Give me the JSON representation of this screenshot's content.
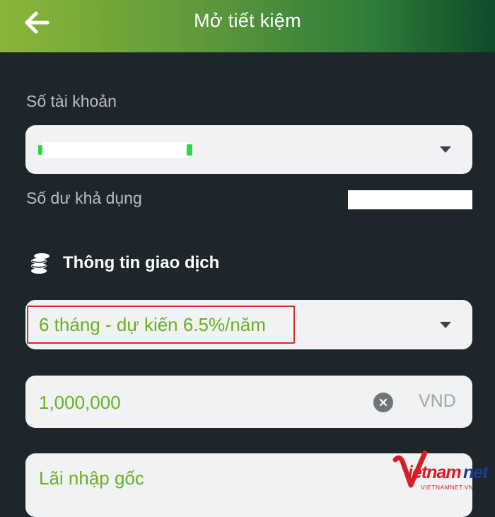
{
  "header": {
    "title": "Mở tiết kiệm",
    "back_icon": "arrow-left-icon"
  },
  "account": {
    "label": "Số tài khoản",
    "value_masked": true
  },
  "balance": {
    "label": "Số dư khả dụng",
    "value_masked": true
  },
  "transaction_section": {
    "title": "Thông tin giao dịch",
    "icon": "coins-icon"
  },
  "term_select": {
    "value": "6 tháng - dự kiến 6.5%/năm"
  },
  "amount_input": {
    "value": "1,000,000",
    "currency": "VND"
  },
  "interest_option": {
    "value": "Lãi nhập gốc"
  },
  "watermark": {
    "brand": "vietnamnet",
    "sub": "VIETNAMNET.VN"
  },
  "colors": {
    "accent_green": "#6ab023",
    "header_gradient_start": "#8bb53a",
    "header_gradient_end": "#0f4a2b",
    "background": "#1c262b",
    "highlight_red": "#d92a2a"
  }
}
